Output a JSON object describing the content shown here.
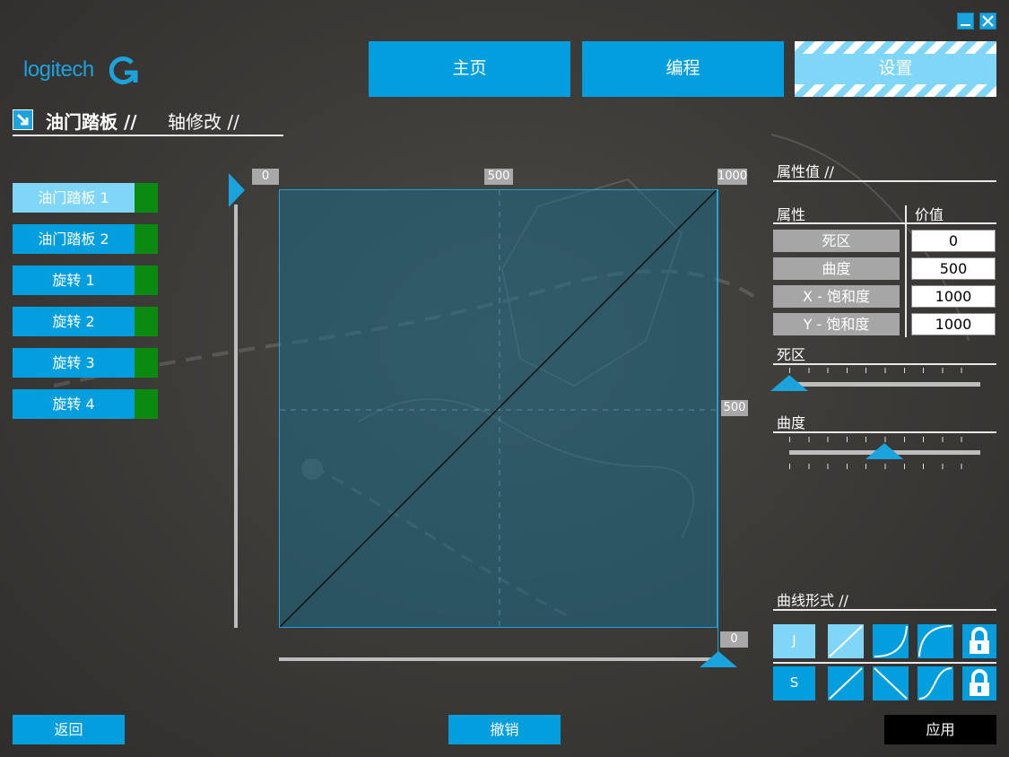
{
  "window": {
    "minimize_icon": "minimize-icon",
    "close_icon": "close-icon"
  },
  "brand": {
    "logo_text": "logitech",
    "accent": "#039ede",
    "accent_light": "#7fd6f6",
    "indicator_green": "#0b8a12"
  },
  "nav": {
    "tabs": [
      {
        "label": "主页",
        "active": false
      },
      {
        "label": "编程",
        "active": false
      },
      {
        "label": "设置",
        "active": true
      }
    ]
  },
  "page": {
    "title": "油门踏板 //",
    "subtitle": "轴修改 //"
  },
  "axes": {
    "items": [
      {
        "label": "油门踏板 1",
        "selected": true
      },
      {
        "label": "油门踏板 2",
        "selected": false
      },
      {
        "label": "旋转 1",
        "selected": false
      },
      {
        "label": "旋转 2",
        "selected": false
      },
      {
        "label": "旋转 3",
        "selected": false
      },
      {
        "label": "旋转 4",
        "selected": false
      }
    ]
  },
  "graph": {
    "top_ticks": [
      "0",
      "500",
      "1000"
    ],
    "right_tick_mid": "500",
    "right_tick_bottom": "0",
    "curve": "linear"
  },
  "properties": {
    "section_title": "属性值 //",
    "header_property": "属性",
    "header_value": "价值",
    "rows": [
      {
        "name": "死区",
        "value": "0"
      },
      {
        "name": "曲度",
        "value": "500"
      },
      {
        "name": "X - 饱和度",
        "value": "1000"
      },
      {
        "name": "Y - 饱和度",
        "value": "1000"
      }
    ]
  },
  "sliders": {
    "deadzone": {
      "label": "死区",
      "value_fraction": 0.0
    },
    "curvature": {
      "label": "曲度",
      "value_fraction": 0.5
    }
  },
  "curve_style": {
    "section_title": "曲线形式 //",
    "row1": [
      {
        "name": "J",
        "selected": true,
        "icon": "letter-j"
      },
      {
        "name": "linear",
        "selected": true,
        "icon": "linear-curve-icon"
      },
      {
        "name": "concave",
        "selected": false,
        "icon": "concave-curve-icon"
      },
      {
        "name": "convex",
        "selected": false,
        "icon": "convex-curve-icon"
      },
      {
        "name": "lock",
        "selected": false,
        "icon": "lock-icon"
      }
    ],
    "row2": [
      {
        "name": "S",
        "selected": false,
        "icon": "letter-s"
      },
      {
        "name": "linear",
        "selected": false,
        "icon": "linear-curve-icon"
      },
      {
        "name": "inverse",
        "selected": false,
        "icon": "inverse-curve-icon"
      },
      {
        "name": "s-curve",
        "selected": false,
        "icon": "s-curve-icon"
      },
      {
        "name": "lock",
        "selected": false,
        "icon": "lock-icon"
      }
    ]
  },
  "footer": {
    "back_label": "返回",
    "undo_label": "撤销",
    "apply_label": "应用"
  }
}
